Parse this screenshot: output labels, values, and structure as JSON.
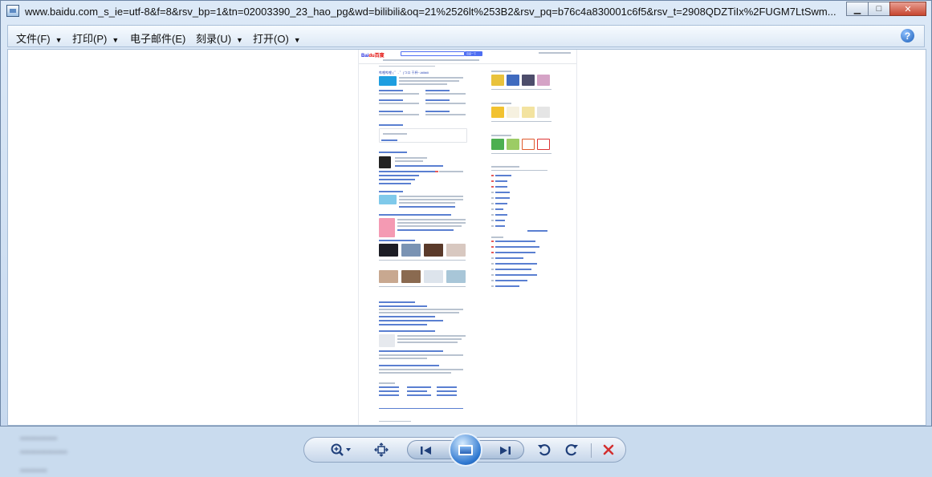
{
  "window": {
    "title": "www.baidu.com_s_ie=utf-8&f=8&rsv_bp=1&tn=02003390_23_hao_pg&wd=bilibili&oq=21%2526lt%253B2&rsv_pq=b76c4a830001c6f5&rsv_t=2908QDZTiIx%2FUGM7LtSwm...",
    "buttons": {
      "minimize": "▁",
      "maximize": "□",
      "close": "✕"
    }
  },
  "menubar": {
    "items": [
      {
        "label": "文件(F)"
      },
      {
        "label": "打印(P)"
      },
      {
        "label": "电子邮件(E)"
      },
      {
        "label": "刻录(U)"
      },
      {
        "label": "打开(O)"
      }
    ],
    "help_icon": "?"
  },
  "preview": {
    "logo_left": "Bai",
    "logo_right": "du百度",
    "search_button": "百度一下",
    "result_title": "哔哩哔哩 ( ゜- ゜)つロ 干杯~-bilibili"
  },
  "controls": {
    "zoom_icon": "zoom-icon",
    "fit_icon": "actual-size-icon",
    "prev_icon": "previous-icon",
    "slideshow_icon": "slideshow-icon",
    "next_icon": "next-icon",
    "rotate_ccw_icon": "rotate-counterclockwise-icon",
    "rotate_cw_icon": "rotate-clockwise-icon",
    "delete_icon": "delete-icon"
  }
}
